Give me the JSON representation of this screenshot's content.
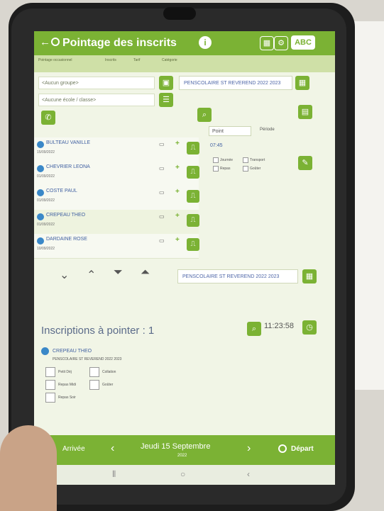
{
  "header": {
    "title": "Pointage des inscrits",
    "badge_label": "ABC"
  },
  "info": {
    "labels": [
      "Pointage occasionnel",
      "Inscrits",
      "Tarif",
      "Catégorie"
    ]
  },
  "filters": {
    "group_placeholder": "<Aucun groupe>",
    "class_placeholder": "<Aucune école / classe>",
    "school_name": "PENSCOLAIRE ST REVEREND 2022 2023"
  },
  "summary": {
    "point_label": "Point",
    "period_label": "Période",
    "time_label": "07:45",
    "checkbox_labels": [
      "Journée",
      "Transport",
      "Repas",
      "Goûter"
    ]
  },
  "students": [
    {
      "name": "BULTEAU VANILLE",
      "date": "15/09/2022"
    },
    {
      "name": "CHEVRIER LEONA",
      "date": "01/09/2022"
    },
    {
      "name": "COSTE PAUL",
      "date": "01/09/2022"
    },
    {
      "name": "CREPEAU THEO",
      "date": "01/09/2022"
    },
    {
      "name": "DARDAINE ROSE",
      "date": "10/09/2022"
    }
  ],
  "school_bottom": "PENSCOLAIRE ST REVEREND 2022 2023",
  "inscriptions": {
    "title": "Inscriptions à pointer : 1",
    "time": "11:23:58",
    "entry_name": "CREPEAU THEO",
    "entry_school": "PENSCOLAIRE ST REVEREND 2022 2023",
    "checks": [
      "Petit Déj",
      "Collation",
      "Repas Midi",
      "Goûter",
      "Repas Soir"
    ]
  },
  "footer": {
    "date_line": "Jeudi 15 Septembre",
    "year": "2022",
    "depart_label": "Départ",
    "left_label": "Arrivée"
  },
  "colors": {
    "accent": "#7bb234",
    "link_blue": "#3f5fa1"
  }
}
